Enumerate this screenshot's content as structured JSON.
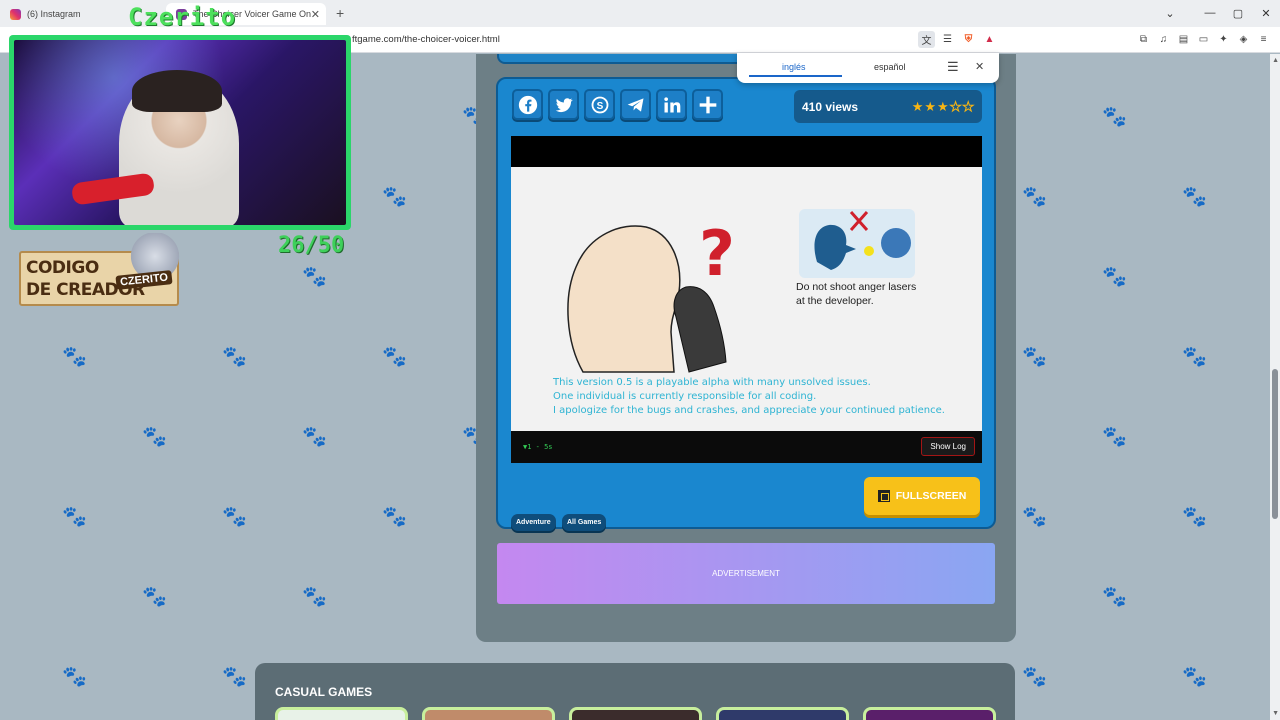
{
  "browser": {
    "tabs": [
      {
        "label": "(6) Instagram"
      },
      {
        "label": "The Choicer Voicer Game Online"
      }
    ],
    "new_tab_label": "+",
    "url": "ftgame.com/the-choicer-voicer.html",
    "window_controls": {
      "list": "⌄",
      "minimize": "—",
      "maximize": "▢",
      "close": "✕"
    }
  },
  "translate_popup": {
    "source_language": "inglés",
    "target_language": "español"
  },
  "share": {
    "buttons": [
      "facebook",
      "twitter",
      "skype",
      "telegram",
      "linkedin",
      "share-plus"
    ]
  },
  "stats": {
    "views": "410 views",
    "rating": 3,
    "rating_max": 5
  },
  "game": {
    "dev_note": [
      "Do not shoot anger lasers",
      "at the developer."
    ],
    "alpha_message": [
      "This version 0.5 is a playable alpha with many unsolved issues.",
      "One individual is currently responsible for all coding.",
      "I apologize for the bugs and crashes, and appreciate your continued patience."
    ],
    "fps_text": "▼1 - 5s",
    "show_log_label": "Show Log"
  },
  "tags": [
    "Adventure",
    "All Games"
  ],
  "fullscreen_label": "FULLSCREEN",
  "advertisement_label": "ADVERTISEMENT",
  "casual_section": {
    "title": "CASUAL GAMES"
  },
  "stream_overlay": {
    "streamer_name": "Czerito",
    "counter": "26/50",
    "creator_code_line1": "CODIGO",
    "creator_code_line2": "DE CREADOR",
    "creator_tag": "CZERITO"
  },
  "colors": {
    "page_bg": "#a9b8c2",
    "card_blue": "#1a87cf",
    "fullscreen_yellow": "#f7c119",
    "overlay_green": "#2bd66a"
  }
}
